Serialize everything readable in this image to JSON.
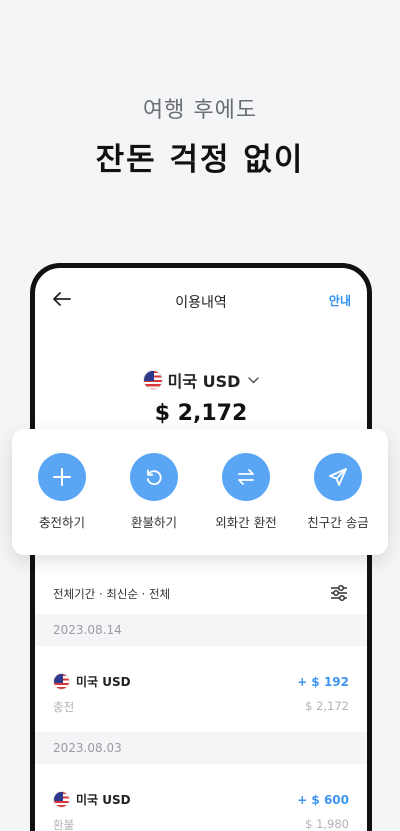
{
  "hero": {
    "subtitle": "여행 후에도",
    "title": "잔돈 걱정 없이"
  },
  "nav": {
    "title": "이용내역",
    "guide": "안내"
  },
  "account": {
    "currency_label": "미국 USD",
    "balance": "$ 2,172"
  },
  "actions": [
    {
      "label": "충전하기",
      "icon": "plus-icon"
    },
    {
      "label": "환불하기",
      "icon": "refresh-icon"
    },
    {
      "label": "외화간 환전",
      "icon": "swap-icon"
    },
    {
      "label": "친구간 송금",
      "icon": "send-icon"
    }
  ],
  "filter": {
    "text": "전체기간 · 최신순 · 전체"
  },
  "groups": [
    {
      "date": "2023.08.14",
      "transactions": [
        {
          "name": "미국 USD",
          "type": "충전",
          "amount": "+ $ 192",
          "balance": "$ 2,172"
        }
      ]
    },
    {
      "date": "2023.08.03",
      "transactions": [
        {
          "name": "미국 USD",
          "type": "환불",
          "amount": "+ $ 600",
          "balance": "$ 1,980"
        }
      ]
    }
  ],
  "colors": {
    "accent": "#5aa6f5",
    "amount": "#3f95f2",
    "guide": "#2f8ff0"
  }
}
